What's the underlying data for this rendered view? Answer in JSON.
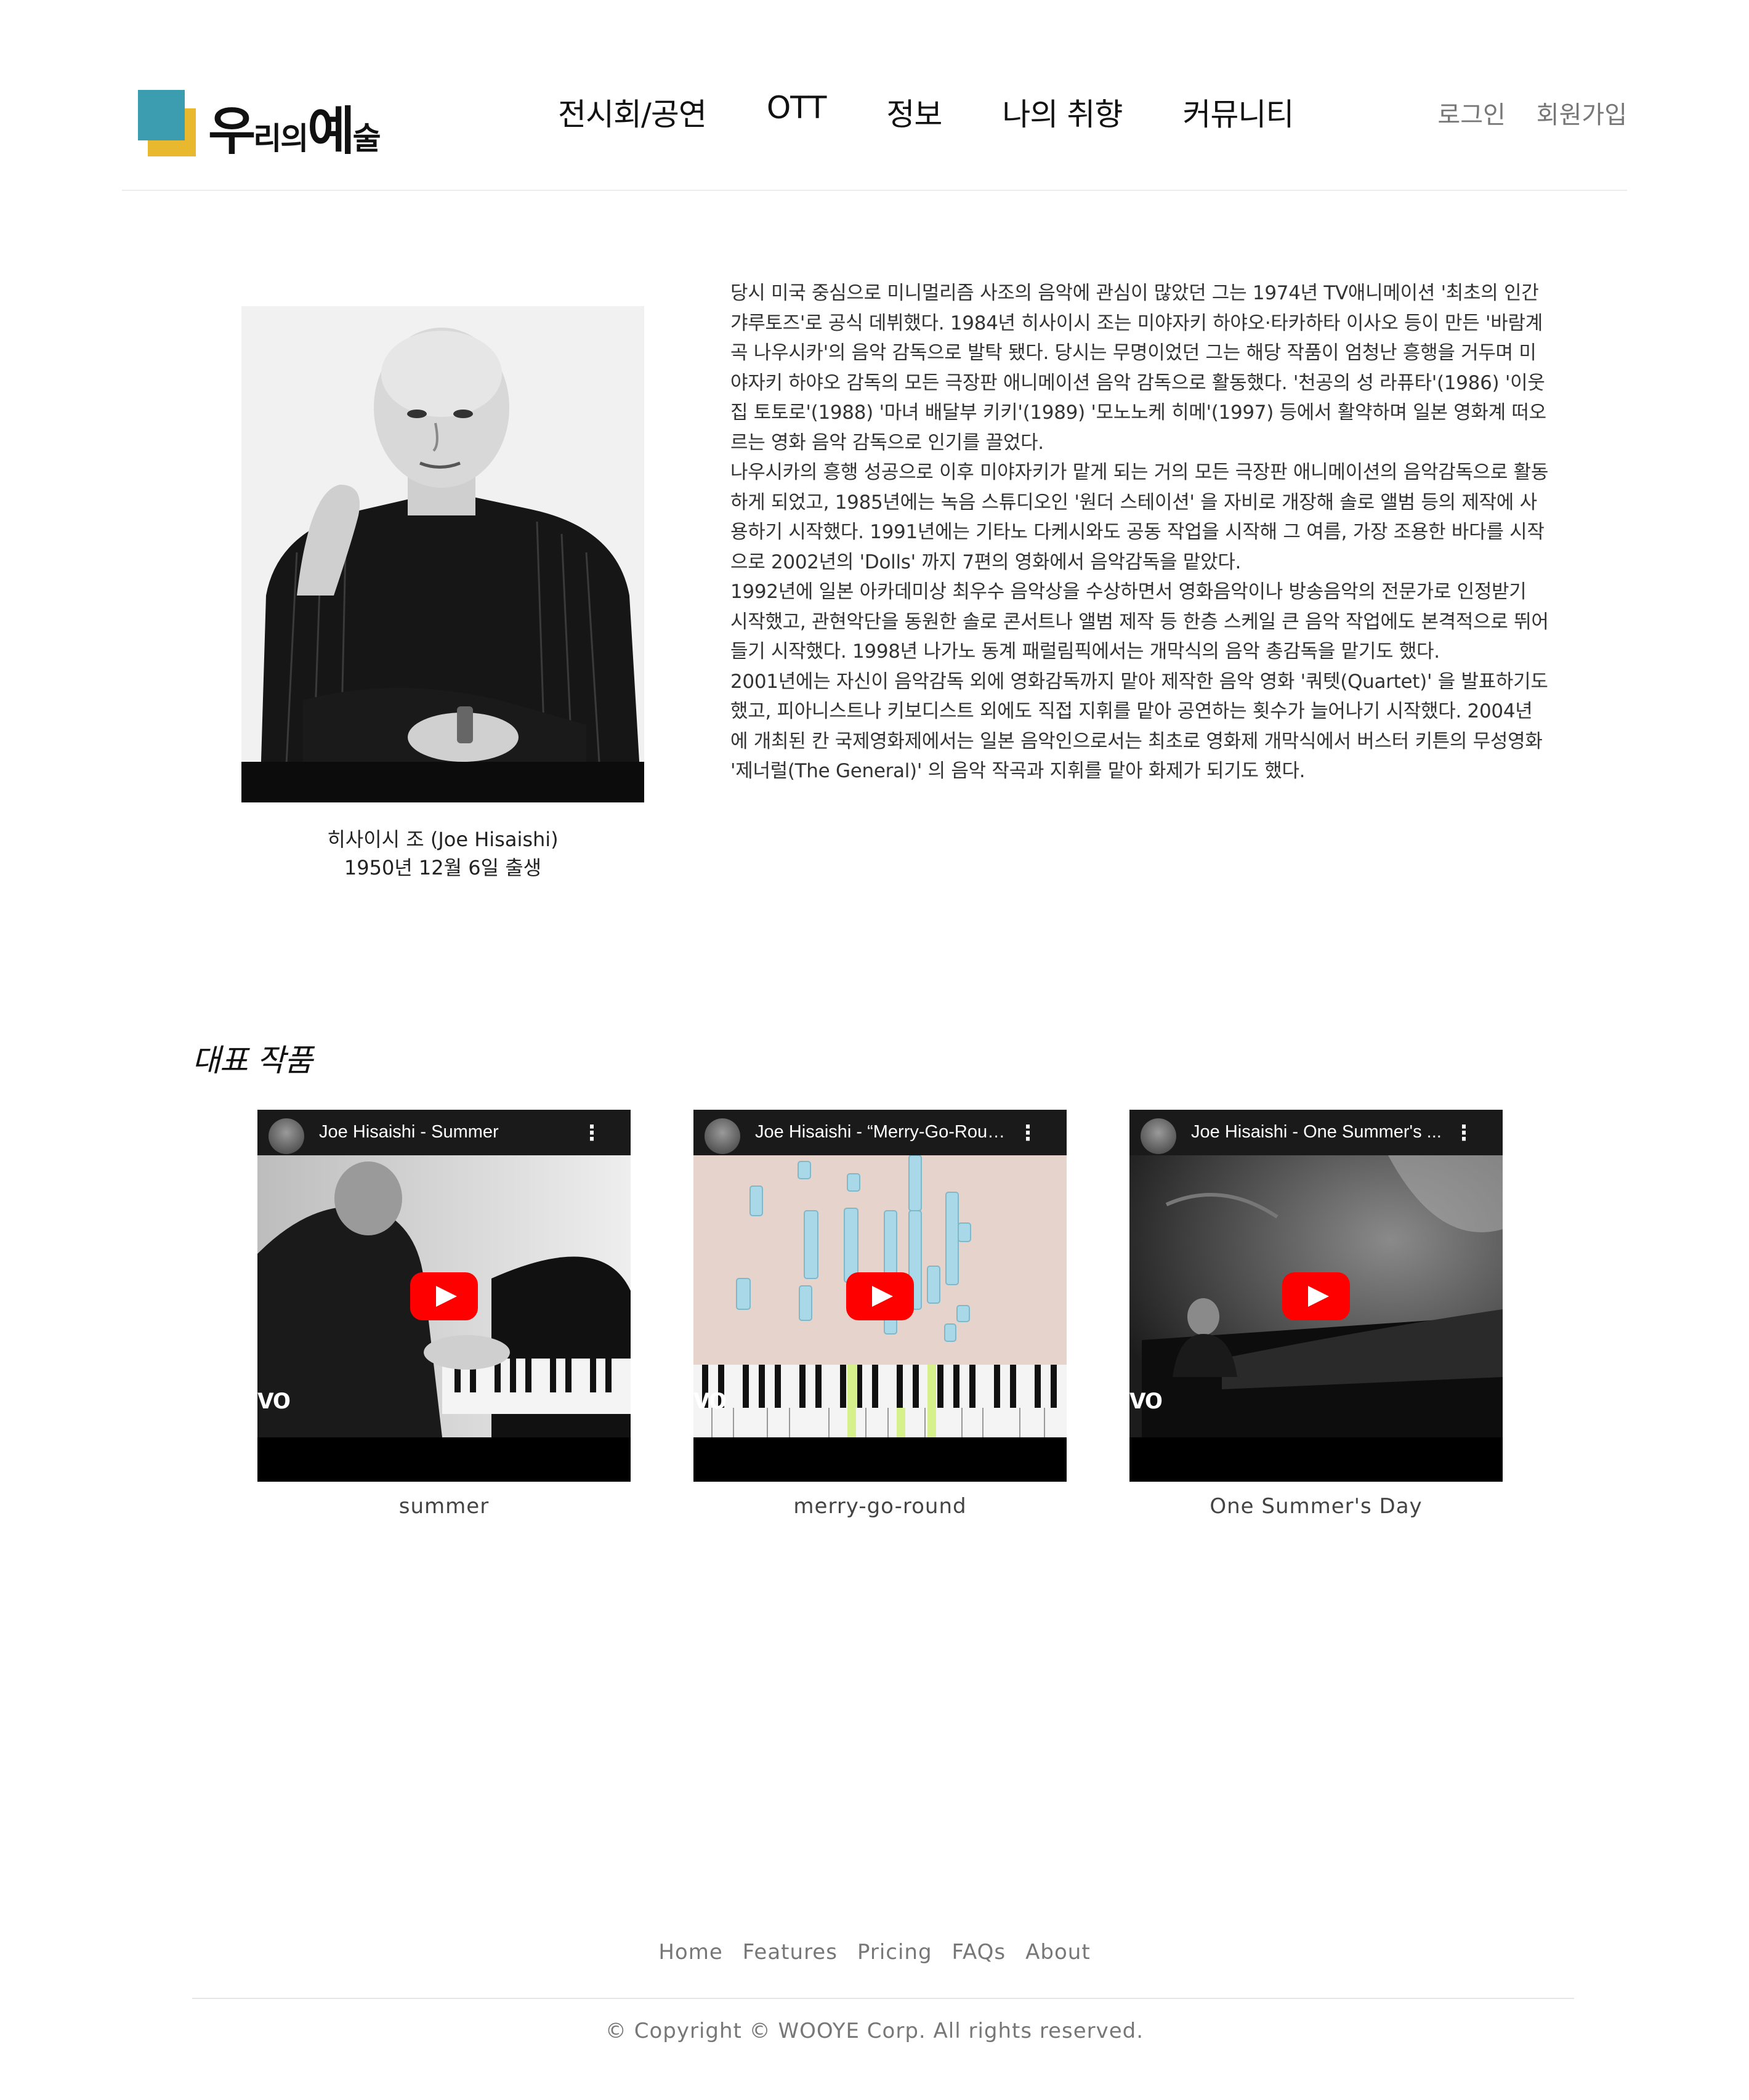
{
  "header": {
    "logo": {
      "part1": "우",
      "part2": "리의",
      "part3": "예",
      "part4": "술"
    },
    "nav": [
      "전시회/공연",
      "OTT",
      "정보",
      "나의 취향",
      "커뮤니티"
    ],
    "auth": {
      "login": "로그인",
      "signup": "회원가입"
    }
  },
  "profile": {
    "name": "히사이시 조 (Joe Hisaishi)",
    "birth": "1950년 12월 6일 출생"
  },
  "bio": [
    "당시 미국 중심으로 미니멀리즘 사조의 음악에 관심이 많았던 그는 1974년 TV애니메이션 '최초의 인간 갸루토즈'로 공식 데뷔했다. 1984년 히사이시 조는 미야자키 하야오·타카하타 이사오 등이 만든 '바람계곡 나우시카'의 음악 감독으로 발탁 됐다. 당시는 무명이었던 그는 해당 작품이 엄청난 흥행을 거두며 미야자키 하야오 감독의 모든 극장판 애니메이션 음악 감독으로 활동했다. '천공의 성 라퓨타'(1986) '이웃집 토토로'(1988) '마녀 배달부 키키'(1989) '모노노케 히메'(1997) 등에서 활약하며 일본 영화계 떠오르는 영화 음악 감독으로 인기를 끌었다.",
    "나우시카의 흥행 성공으로 이후 미야자키가 맡게 되는 거의 모든 극장판 애니메이션의 음악감독으로 활동하게 되었고, 1985년에는 녹음 스튜디오인 '원더 스테이션' 을 자비로 개장해 솔로 앨범 등의 제작에 사용하기 시작했다. 1991년에는 기타노 다케시와도 공동 작업을 시작해 그 여름, 가장 조용한 바다를 시작으로 2002년의 'Dolls' 까지 7편의 영화에서 음악감독을 맡았다.",
    "1992년에 일본 아카데미상 최우수 음악상을 수상하면서 영화음악이나 방송음악의 전문가로 인정받기 시작했고, 관현악단을 동원한 솔로 콘서트나 앨범 제작 등 한층 스케일 큰 음악 작업에도 본격적으로 뛰어들기 시작했다. 1998년 나가노 동계 패럴림픽에서는 개막식의 음악 총감독을 맡기도 했다.",
    "2001년에는 자신이 음악감독 외에 영화감독까지 맡아 제작한 음악 영화 '쿼텟(Quartet)' 을 발표하기도 했고, 피아니스트나 키보디스트 외에도 직접 지휘를 맡아 공연하는 횟수가 늘어나기 시작했다. 2004년에 개최된 칸 국제영화제에서는 일본 음악인으로서는 최초로 영화제 개막식에서 버스터 키튼의 무성영화 '제너럴(The General)' 의 음악 작곡과 지휘를 맡아 화제가 되기도 했다."
  ],
  "works": {
    "title": "대표 작품",
    "videos": [
      {
        "title": "Joe Hisaishi - Summer",
        "caption": "summer"
      },
      {
        "title": "Joe Hisaishi - “Merry-Go-Roun...",
        "caption": "merry-go-round"
      },
      {
        "title": "Joe Hisaishi - One Summer's ...",
        "caption": "One Summer's Day"
      }
    ],
    "overlay_text": "vo"
  },
  "footer": {
    "links": [
      "Home",
      "Features",
      "Pricing",
      "FAQs",
      "About"
    ],
    "copyright": "© Copyright © WOOYE Corp. All rights reserved."
  },
  "colors": {
    "logo_teal": "#3d9db0",
    "logo_yellow": "#e8b92f",
    "play_red": "#ff0000"
  }
}
